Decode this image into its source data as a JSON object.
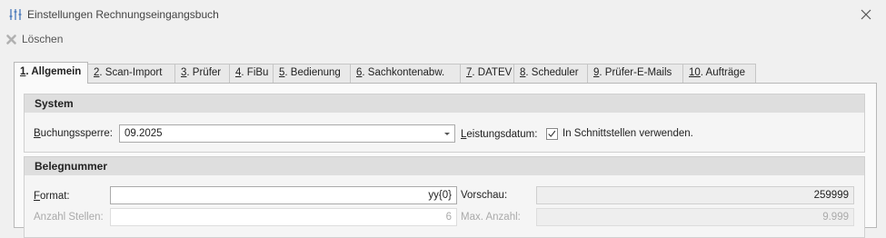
{
  "window": {
    "title": "Einstellungen Rechnungseingangsbuch"
  },
  "toolbar": {
    "delete_label": "Löschen"
  },
  "tabs": [
    {
      "num": "1",
      "label": ". Allgemein"
    },
    {
      "num": "2",
      "label": ". Scan-Import"
    },
    {
      "num": "3",
      "label": ". Prüfer"
    },
    {
      "num": "4",
      "label": ". FiBu"
    },
    {
      "num": "5",
      "label": ". Bedienung"
    },
    {
      "num": "6",
      "label": ". Sachkontenabw."
    },
    {
      "num": "7",
      "label": ". DATEV"
    },
    {
      "num": "8",
      "label": ". Scheduler"
    },
    {
      "num": "9",
      "label": ". Prüfer-E-Mails"
    },
    {
      "num": "10",
      "label": ". Aufträge"
    }
  ],
  "system": {
    "header": "System",
    "buchungssperre_first": "B",
    "buchungssperre_rest": "uchungssperre:",
    "buchungssperre_value": "09.2025",
    "leistungsdatum_first": "L",
    "leistungsdatum_rest": "eistungsdatum:",
    "schnittstellen_label": "In Schnittstellen verwenden.",
    "schnittstellen_checked": true
  },
  "belegnummer": {
    "header": "Belegnummer",
    "format_first": "F",
    "format_rest": "ormat:",
    "format_value": "yy{0}",
    "vorschau_label": "Vorschau:",
    "vorschau_value": "259999",
    "anzahl_stellen_label": "Anzahl Stellen:",
    "anzahl_stellen_value": "6",
    "max_anzahl_label": "Max. Anzahl:",
    "max_anzahl_value": "9.999"
  }
}
